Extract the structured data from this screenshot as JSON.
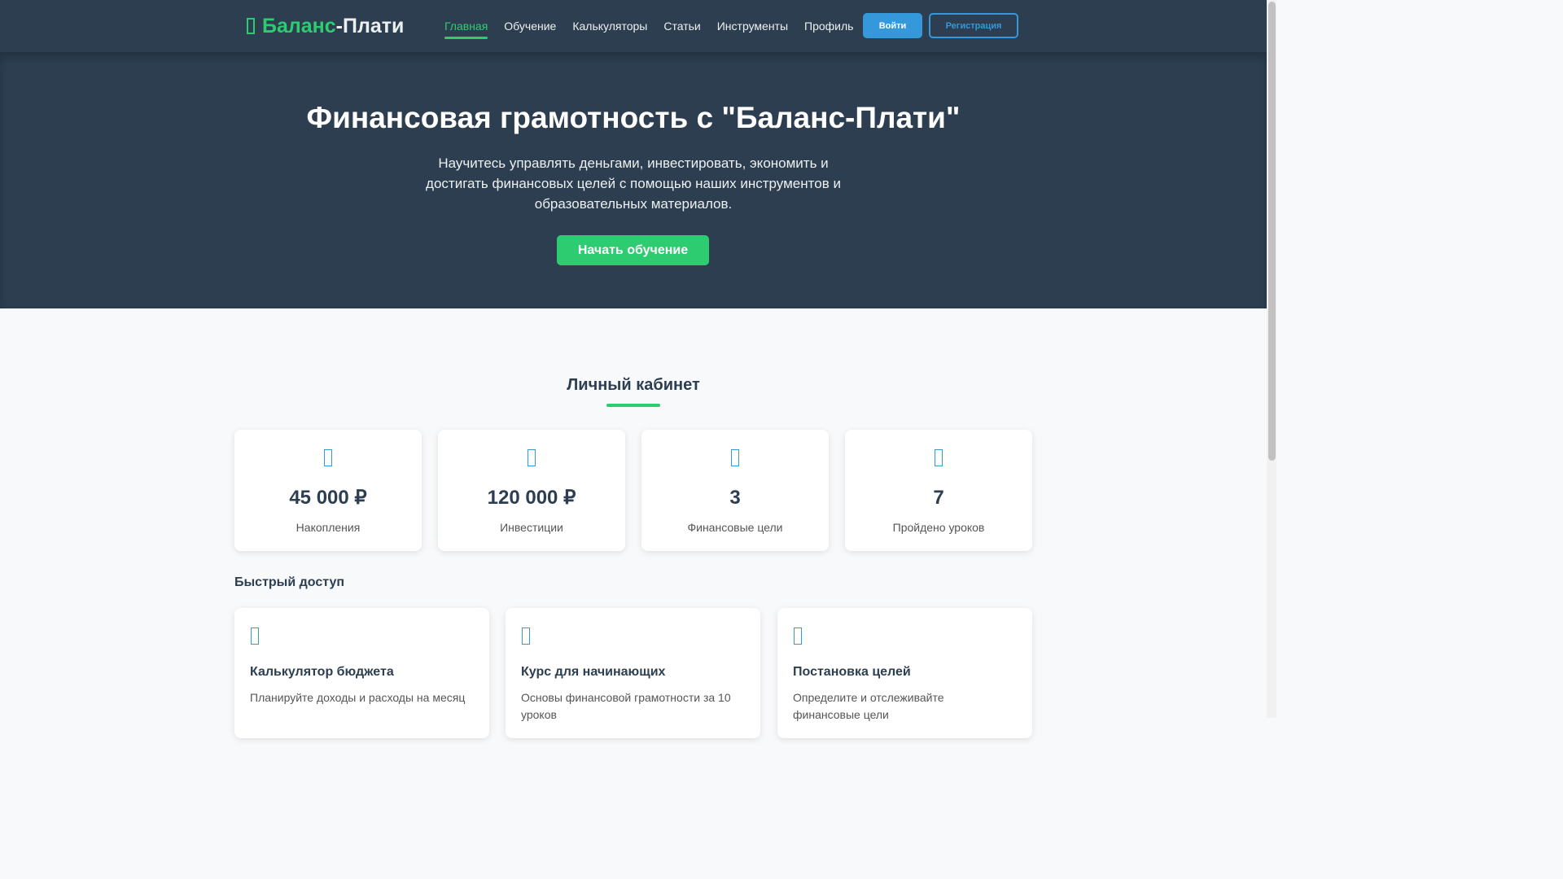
{
  "header": {
    "logo_accent": "Баланс",
    "logo_rest": "-Плати",
    "logo_icon": "wallet-icon",
    "nav": [
      {
        "label": "Главная",
        "active": true
      },
      {
        "label": "Обучение",
        "active": false
      },
      {
        "label": "Калькуляторы",
        "active": false
      },
      {
        "label": "Статьи",
        "active": false
      },
      {
        "label": "Инструменты",
        "active": false
      },
      {
        "label": "Профиль",
        "active": false
      }
    ],
    "login_label": "Войти",
    "register_label": "Регистрация"
  },
  "hero": {
    "title": "Финансовая грамотность с \"Баланс-Плати\"",
    "subtitle": "Научитесь управлять деньгами, инвестировать, экономить и достигать финансовых целей с помощью наших инструментов и образовательных материалов.",
    "cta_label": "Начать обучение"
  },
  "dashboard": {
    "title": "Личный кабинет",
    "stats": [
      {
        "value": "45 000 ₽",
        "label": "Накопления",
        "icon": "piggy-bank-icon"
      },
      {
        "value": "120 000 ₽",
        "label": "Инвестиции",
        "icon": "chart-line-icon"
      },
      {
        "value": "3",
        "label": "Финансовые цели",
        "icon": "bullseye-icon"
      },
      {
        "value": "7",
        "label": "Пройдено уроков",
        "icon": "graduation-cap-icon"
      }
    ]
  },
  "quick_access": {
    "title": "Быстрый доступ",
    "cards": [
      {
        "title": "Калькулятор бюджета",
        "desc": "Планируйте доходы и расходы на месяц",
        "icon": "calculator-icon"
      },
      {
        "title": "Курс для начинающих",
        "desc": "Основы финансовой грамотности за 10 уроков",
        "icon": "book-icon"
      },
      {
        "title": "Постановка целей",
        "desc": "Определите и отслеживайте финансовые цели",
        "icon": "flag-icon"
      }
    ]
  },
  "colors": {
    "primary_dark": "#2c3e50",
    "accent_green": "#2ecc71",
    "accent_blue": "#3498db"
  }
}
